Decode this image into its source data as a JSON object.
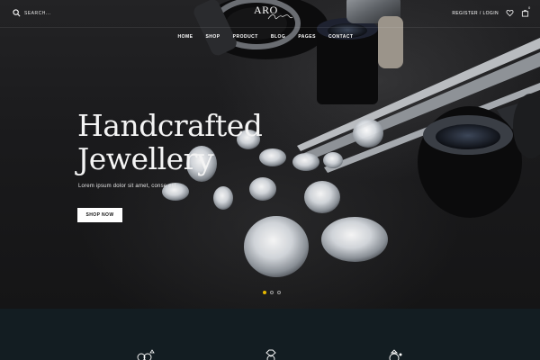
{
  "header": {
    "search": {
      "placeholder": "SEARCH..."
    },
    "logo": {
      "text": "ARO"
    },
    "register_label": "REGISTER / LOGIN",
    "cart_count": "0"
  },
  "nav": {
    "items": [
      {
        "label": "HOME"
      },
      {
        "label": "SHOP"
      },
      {
        "label": "PRODUCT"
      },
      {
        "label": "BLOG"
      },
      {
        "label": "PAGES"
      },
      {
        "label": "CONTACT"
      }
    ]
  },
  "hero": {
    "title_line1": "Handcrafted",
    "title_line2": "Jewellery",
    "subtitle": "Lorem ipsum dolor sit amet, conse elit",
    "cta_label": "SHOP NOW",
    "slider": {
      "count": 3,
      "active": 1
    }
  },
  "icons": {
    "search": "search-icon",
    "wishlist": "heart-icon",
    "cart": "cart-icon",
    "features": [
      "rings-icon",
      "diamond-ring-icon",
      "ring-icon"
    ]
  },
  "colors": {
    "footer_band": "#131d22",
    "active_dot": "#e6b800",
    "button_bg": "#ffffff"
  }
}
